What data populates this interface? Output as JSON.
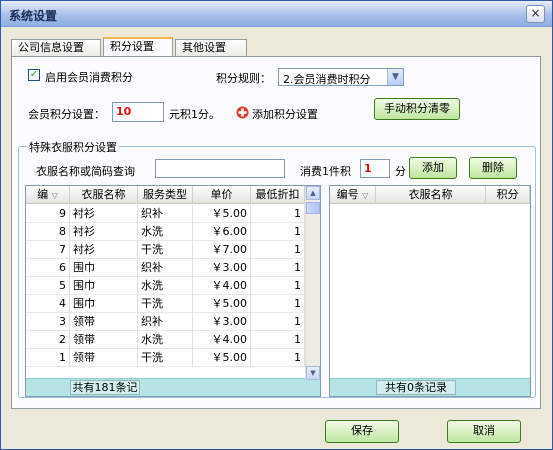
{
  "window": {
    "title": "系统设置",
    "close_label": "×"
  },
  "tabs": [
    "公司信息设置",
    "积分设置",
    "其他设置"
  ],
  "settings": {
    "enable_member_points_label": "启用会员消费积分",
    "enable_member_points_checked": "✓",
    "points_rule_label": "积分规则：",
    "points_rule_value": "2.会员消费时积分",
    "member_points_label": "会员积分设置：",
    "member_points_value": "10",
    "member_points_unit": "元积1分。",
    "add_points_label": "添加积分设置",
    "manual_clear_label": "手动积分清零"
  },
  "special": {
    "group_title": "特殊衣服积分设置",
    "search_label": "衣服名称或简码查询",
    "search_value": "",
    "per_item_label": "消费1件积",
    "per_item_value": "1",
    "per_item_unit": "分",
    "add_label": "添加",
    "delete_label": "删除"
  },
  "left_grid": {
    "headers": [
      "编",
      "衣服名称",
      "服务类型",
      "单价",
      "最低折扣"
    ],
    "rows": [
      [
        "9",
        "衬衫",
        "织补",
        "￥5.00",
        "1"
      ],
      [
        "8",
        "衬衫",
        "水洗",
        "￥6.00",
        "1"
      ],
      [
        "7",
        "衬衫",
        "干洗",
        "￥7.00",
        "1"
      ],
      [
        "6",
        "围巾",
        "织补",
        "￥3.00",
        "1"
      ],
      [
        "5",
        "围巾",
        "水洗",
        "￥4.00",
        "1"
      ],
      [
        "4",
        "围巾",
        "干洗",
        "￥5.00",
        "1"
      ],
      [
        "3",
        "领带",
        "织补",
        "￥3.00",
        "1"
      ],
      [
        "2",
        "领带",
        "水洗",
        "￥4.00",
        "1"
      ],
      [
        "1",
        "领带",
        "干洗",
        "￥5.00",
        "1"
      ]
    ],
    "footer": "共有181条记"
  },
  "right_grid": {
    "headers": [
      "编号",
      "衣服名称",
      "积分"
    ],
    "footer": "共有0条记录"
  },
  "footer_buttons": {
    "save": "保存",
    "cancel": "取消"
  },
  "colors": {
    "accent_tab": "#f6b74d",
    "footer_bar": "#b6e4e6",
    "red_value": "#e01010"
  }
}
